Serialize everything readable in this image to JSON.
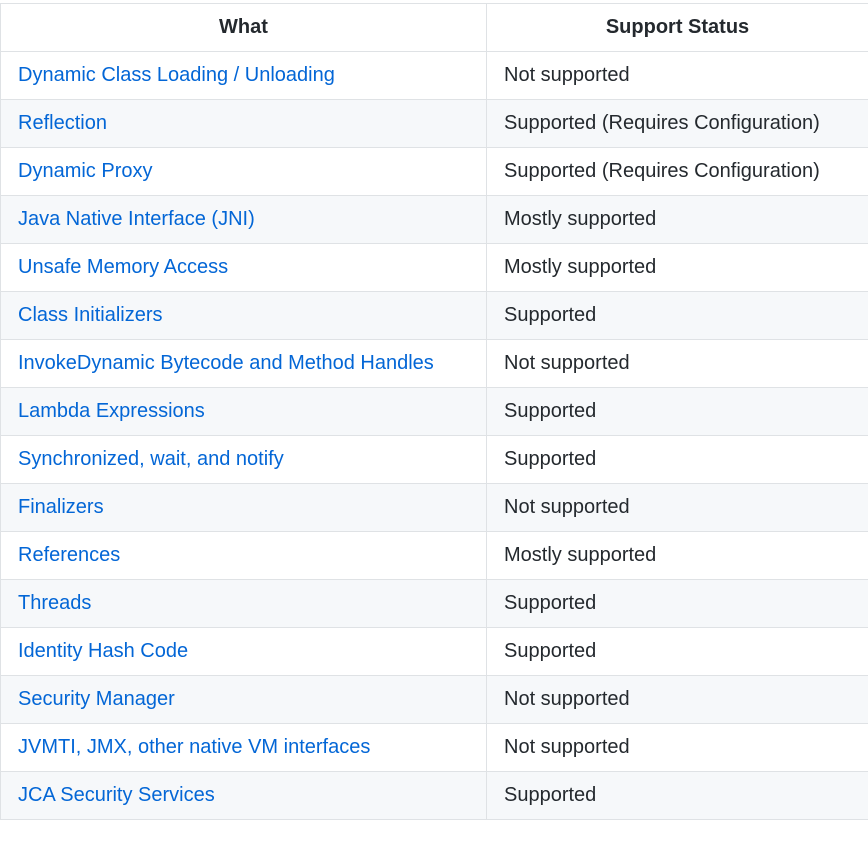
{
  "table": {
    "headers": {
      "what": "What",
      "status": "Support Status"
    },
    "rows": [
      {
        "what": "Dynamic Class Loading / Unloading",
        "status": "Not supported"
      },
      {
        "what": "Reflection",
        "status": "Supported (Requires Configuration)"
      },
      {
        "what": "Dynamic Proxy",
        "status": "Supported (Requires Configuration)"
      },
      {
        "what": "Java Native Interface (JNI)",
        "status": "Mostly supported"
      },
      {
        "what": "Unsafe Memory Access",
        "status": "Mostly supported"
      },
      {
        "what": "Class Initializers",
        "status": "Supported"
      },
      {
        "what": "InvokeDynamic Bytecode and Method Handles",
        "status": "Not supported"
      },
      {
        "what": "Lambda Expressions",
        "status": "Supported"
      },
      {
        "what": "Synchronized, wait, and notify",
        "status": "Supported"
      },
      {
        "what": "Finalizers",
        "status": "Not supported"
      },
      {
        "what": "References",
        "status": "Mostly supported"
      },
      {
        "what": "Threads",
        "status": "Supported"
      },
      {
        "what": "Identity Hash Code",
        "status": "Supported"
      },
      {
        "what": "Security Manager",
        "status": "Not supported"
      },
      {
        "what": "JVMTI, JMX, other native VM interfaces",
        "status": "Not supported"
      },
      {
        "what": "JCA Security Services",
        "status": "Supported"
      }
    ]
  },
  "colors": {
    "link": "#0366d6",
    "text": "#24292e",
    "border": "#dfe2e5",
    "stripe": "#f6f8fa"
  }
}
